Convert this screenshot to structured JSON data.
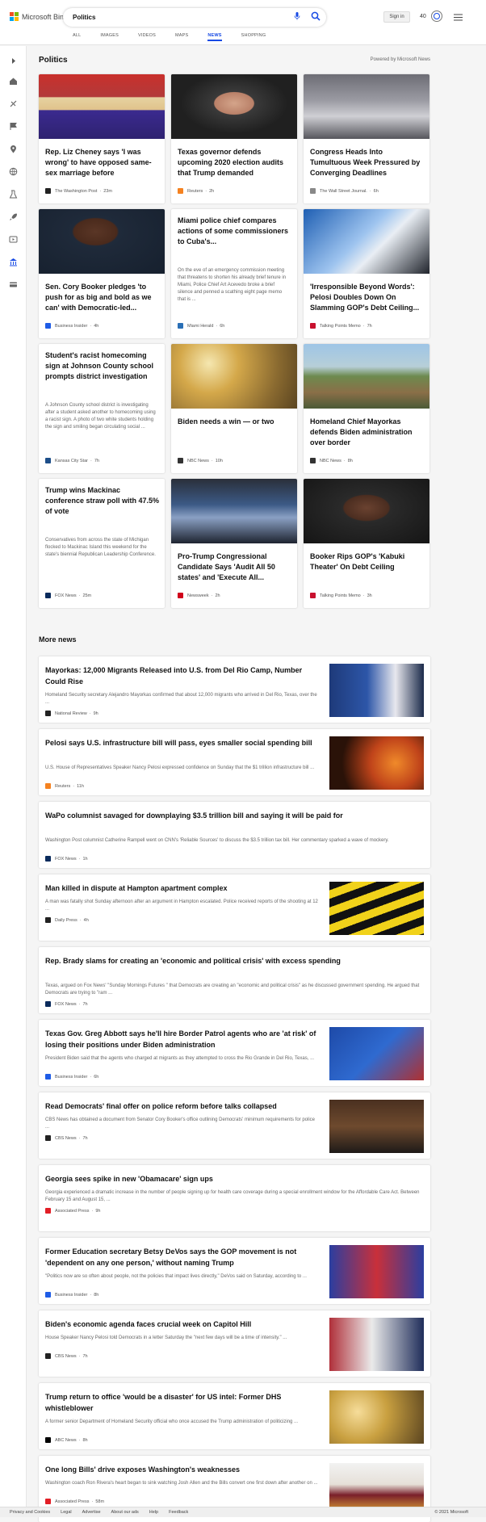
{
  "header": {
    "logo": "Microsoft Bing",
    "logo_colors": [
      "#f25022",
      "#7fba00",
      "#00a4ef",
      "#ffb900"
    ],
    "search_value": "Politics",
    "signin_label": "Sign in",
    "points": "40",
    "accent": "#174ae4",
    "icons": [
      "mic-icon",
      "search-icon",
      "rewards-icon",
      "menu-icon"
    ]
  },
  "tabs": [
    {
      "label": "ALL",
      "active": false
    },
    {
      "label": "IMAGES",
      "active": false
    },
    {
      "label": "VIDEOS",
      "active": false
    },
    {
      "label": "MAPS",
      "active": false
    },
    {
      "label": "NEWS",
      "active": true
    },
    {
      "label": "SHOPPING",
      "active": false
    }
  ],
  "rail_icons": [
    "expand-icon",
    "home-icon",
    "sports-icon",
    "flag-icon",
    "location-icon",
    "world-icon",
    "science-icon",
    "rocket-icon",
    "entertainment-icon",
    "politics-icon",
    "money-icon"
  ],
  "section": {
    "title": "Politics",
    "powered": "Powered by Microsoft News"
  },
  "cards": [
    {
      "title": "Rep. Liz Cheney says 'I was wrong' to have opposed same-sex marriage before",
      "snippet": "",
      "source": "The Washington Post",
      "time": "23m",
      "has_image": true,
      "img": "cheney",
      "fav_color": "#222"
    },
    {
      "title": "Texas governor defends upcoming 2020 election audits that Trump demanded",
      "snippet": "",
      "source": "Reuters",
      "time": "2h",
      "has_image": true,
      "img": "abbott",
      "fav_color": "#f58220"
    },
    {
      "title": "Congress Heads Into Tumultuous Week Pressured by Converging Deadlines",
      "snippet": "",
      "source": "The Wall Street Journal.",
      "time": "6h",
      "has_image": true,
      "img": "capitol",
      "fav_color": "#888"
    },
    {
      "title": "Sen. Cory Booker pledges 'to push for as big and bold as we can' with Democratic-led...",
      "snippet": "",
      "source": "Business Insider",
      "time": "4h",
      "has_image": true,
      "img": "booker",
      "fav_color": "#1e5ce6"
    },
    {
      "title": "Miami police chief compares actions of some commissioners to Cuba's...",
      "snippet": "On the eve of an emergency commission meeting that threatens to shorten his already brief tenure in Miami, Police Chief Art Acevedo broke a brief silence and penned a scathing eight page memo that is ...",
      "source": "Miami Herald",
      "time": "6h",
      "has_image": false,
      "img": "",
      "fav_color": "#2a6fb6"
    },
    {
      "title": "'Irresponsible Beyond Words': Pelosi Doubles Down On Slamming GOP's Debt Ceiling...",
      "snippet": "",
      "source": "Talking Points Memo",
      "time": "7h",
      "has_image": true,
      "img": "pelosi",
      "fav_color": "#c8102e"
    },
    {
      "title": "Student's racist homecoming sign at Johnson County school prompts district investigation",
      "snippet": "A Johnson County school district is investigating after a student asked another to homecoming using a racist sign. A photo of two white students holding the sign and smiling began circulating social ...",
      "source": "Kansas City Star",
      "time": "7h",
      "has_image": false,
      "img": "",
      "fav_color": "#1d4e89"
    },
    {
      "title": "Biden needs a win — or two",
      "snippet": "",
      "source": "NBC News",
      "time": "10h",
      "has_image": true,
      "img": "biden",
      "fav_color": "#333"
    },
    {
      "title": "Homeland Chief Mayorkas defends Biden administration over border",
      "snippet": "",
      "source": "NBC News",
      "time": "8h",
      "has_image": true,
      "img": "border",
      "fav_color": "#333"
    },
    {
      "title": "Trump wins Mackinac conference straw poll with 47.5% of vote",
      "snippet": "Conservatives from across the state of Michigan flocked to Mackinac Island this weekend for the state's biennial Republican Leadership Conference.",
      "source": "FOX News",
      "time": "25m",
      "has_image": false,
      "img": "",
      "fav_color": "#0a2b5c"
    },
    {
      "title": "Pro-Trump Congressional Candidate Says 'Audit All 50 states' and 'Execute All...",
      "snippet": "",
      "source": "Newsweek",
      "time": "2h",
      "has_image": true,
      "img": "audit",
      "fav_color": "#d0021b"
    },
    {
      "title": "Booker Rips GOP's 'Kabuki Theater' On Debt Ceiling",
      "snippet": "",
      "source": "Talking Points Memo",
      "time": "3h",
      "has_image": true,
      "img": "booker2",
      "fav_color": "#c8102e"
    }
  ],
  "more_news": {
    "title": "More news",
    "items": [
      {
        "title": "Mayorkas: 12,000 Migrants Released into U.S. from Del Rio Camp, Number Could Rise",
        "snippet": "Homeland Security secretary Alejandro Mayorkas confirmed that about 12,000 migrants who arrived in Del Rio, Texas, over the ...",
        "source": "National Review",
        "time": "9h",
        "has_image": true,
        "img": "mayorkas",
        "fav_color": "#222"
      },
      {
        "title": "Pelosi says U.S. infrastructure bill will pass, eyes smaller social spending bill",
        "snippet": "U.S. House of Representatives Speaker Nancy Pelosi expressed confidence on Sunday that the $1 trillion infrastructure bill ...",
        "source": "Reuters",
        "time": "11h",
        "has_image": true,
        "img": "pelosi2",
        "fav_color": "#f58220"
      },
      {
        "title": "WaPo columnist savaged for downplaying $3.5 trillion bill and saying it will be paid for",
        "snippet": "Washington Post columnist Catherine Rampell went on CNN's 'Reliable Sources' to discuss the $3.5 trillion tax bill. Her commentary sparked a wave of mockery.",
        "source": "FOX News",
        "time": "1h",
        "has_image": false,
        "img": "",
        "fav_color": "#0a2b5c"
      },
      {
        "title": "Man killed in dispute at Hampton apartment complex",
        "snippet": "A man was fatally shot Sunday afternoon after an argument in Hampton escalated. Police received reports of the shooting at 12 ...",
        "source": "Daily Press",
        "time": "4h",
        "has_image": true,
        "img": "crime",
        "fav_color": "#222"
      },
      {
        "title": "Rep. Brady slams for creating an 'economic and political crisis' with excess spending",
        "snippet": "Texas, argued on Fox News' \"Sunday Mornings Futures \" that Democrats are creating an \"economic and political crisis\" as he discussed government spending. He argued that Democrats are trying to \"ram ...",
        "source": "FOX News",
        "time": "7h",
        "has_image": false,
        "img": "",
        "fav_color": "#0a2b5c"
      },
      {
        "title": "Texas Gov. Greg Abbott says he'll hire Border Patrol agents who are 'at risk' of losing their positions under Biden administration",
        "snippet": "President Biden said that the agents who charged at migrants as they attempted to cross the Rio Grande in Del Rio, Texas, ...",
        "source": "Business Insider",
        "time": "6h",
        "has_image": true,
        "img": "abbott2",
        "fav_color": "#1e5ce6"
      },
      {
        "title": "Read Democrats' final offer on police reform before talks collapsed",
        "snippet": "CBS News has obtained a document from Senator Cory Booker's office outlining Democrats' minimum requirements for police ...",
        "source": "CBS News",
        "time": "7h",
        "has_image": true,
        "img": "senate",
        "fav_color": "#222"
      },
      {
        "title": "Georgia sees spike in new 'Obamacare' sign ups",
        "snippet": "Georgia experienced a dramatic increase in the number of people signing up for health care coverage during a special enrollment window for the Affordable Care Act. Between February 15 and August 15, ...",
        "source": "Associated Press",
        "time": "9h",
        "has_image": false,
        "img": "",
        "fav_color": "#e21e26"
      },
      {
        "title": "Former Education secretary Betsy DeVos says the GOP movement is not 'dependent on any one person,' without naming Trump",
        "snippet": "\"Politics now are so often about people, not the policies that impact lives directly,\" DeVos said on Saturday, according to ...",
        "source": "Business Insider",
        "time": "8h",
        "has_image": true,
        "img": "devos",
        "fav_color": "#1e5ce6"
      },
      {
        "title": "Biden's economic agenda faces crucial week on Capitol Hill",
        "snippet": "House Speaker Nancy Pelosi told Democrats in a letter Saturday the \"next few days will be a time of intensity.\" ...",
        "source": "CBS News",
        "time": "7h",
        "has_image": true,
        "img": "biden2",
        "fav_color": "#222"
      },
      {
        "title": "Trump return to office 'would be a disaster' for US intel: Former DHS whistleblower",
        "snippet": "A former senior Department of Homeland Security official who once accused the Trump administration of politicizing ...",
        "source": "ABC News",
        "time": "8h",
        "has_image": true,
        "img": "whistle",
        "fav_color": "#000"
      },
      {
        "title": "One long Bills' drive exposes Washington's weaknesses",
        "snippet": "Washington coach Ron Rivera's heart began to sink watching Josh Allen and the Bills convert one first down after another on ...",
        "source": "Associated Press",
        "time": "58m",
        "has_image": true,
        "img": "football",
        "fav_color": "#e21e26"
      }
    ]
  },
  "footer": {
    "links": [
      "Privacy and Cookies",
      "Legal",
      "Advertise",
      "About our ads",
      "Help",
      "Feedback"
    ],
    "copyright": "© 2021 Microsoft"
  }
}
